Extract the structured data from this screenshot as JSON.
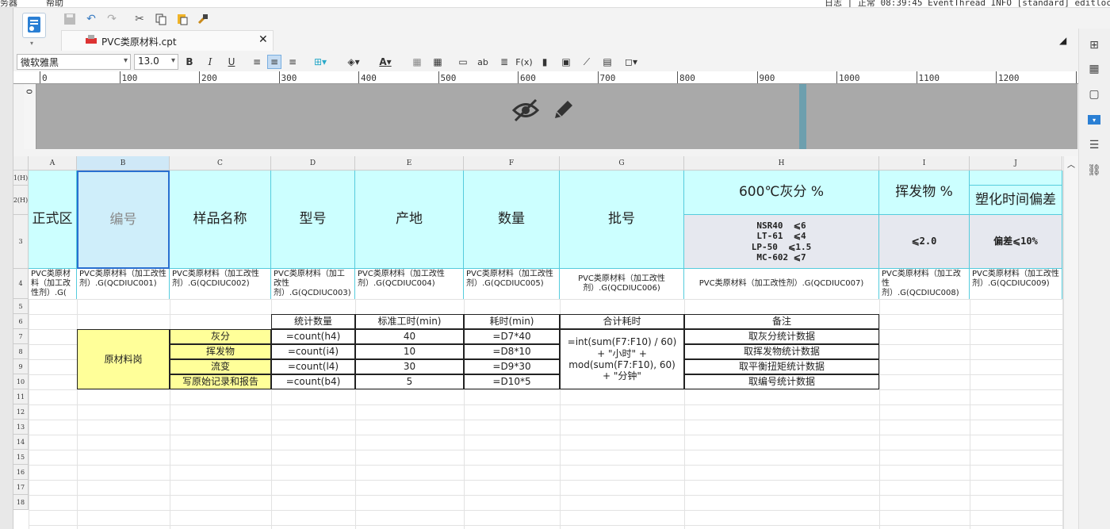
{
  "topbar": {
    "left1": "务器",
    "left2": "帮助",
    "right": "日志  | 正常 08:39:45 EventThread INFO [standard] editlock o"
  },
  "tab": {
    "title": "PVC类原材料.cpt"
  },
  "format": {
    "font": "微软雅黑",
    "size": "13.0",
    "bold": "B",
    "italic": "I",
    "underline": "U",
    "text_color": "A",
    "formula": "F(x)",
    "ab": "ab"
  },
  "ruler": {
    "ticks": [
      "0",
      "100",
      "200",
      "300",
      "400",
      "500",
      "600",
      "700",
      "800",
      "900",
      "1000",
      "1100",
      "1200",
      "13"
    ],
    "v_tick": "0"
  },
  "columns": [
    "A",
    "B",
    "C",
    "D",
    "E",
    "F",
    "G",
    "H",
    "I",
    "J"
  ],
  "rows": [
    "1(H)",
    "2(H)",
    "3",
    "4",
    "5",
    "6",
    "7",
    "8",
    "9",
    "10",
    "11",
    "12",
    "13",
    "14",
    "15",
    "16",
    "17",
    "18"
  ],
  "header": {
    "A": "正式区",
    "B": "编号",
    "C": "样品名称",
    "D": "型号",
    "E": "产地",
    "F": "数量",
    "G": "批号",
    "H": "600℃灰分 %",
    "I": "挥发物 %",
    "J": "塑化时间偏差"
  },
  "row3": {
    "H": "NSR40  ⩽6\nLT-61  ⩽4\nLP-50  ⩽1.5\nMC-602 ⩽7",
    "I": "⩽2.0",
    "J": "偏差⩽10%"
  },
  "row4": {
    "A": "PVC类原材料（加工改性剂）.G(",
    "B": "PVC类原材料（加工改性剂）.G(QCDIUC001)",
    "C": "PVC类原材料（加工改性剂）.G(QCDIUC002)",
    "D": "PVC类原材料（加工改性剂）.G(QCDIUC003)",
    "E": "PVC类原材料（加工改性剂）.G(QCDIUC004)",
    "F": "PVC类原材料（加工改性剂）.G(QCDIUC005)",
    "G": "PVC类原材料（加工改性剂）.G(QCDIUC006)",
    "H": "PVC类原材料（加工改性剂）.G(QCDIUC007)",
    "I": "PVC类原材料（加工改性剂）.G(QCDIUC008)",
    "J": "PVC类原材料（加工改性剂）.G(QCDIUC009)"
  },
  "stats": {
    "headers": [
      "统计数量",
      "标准工时(min)",
      "耗时(min)",
      "合计耗时",
      "备注"
    ],
    "group": "原材料岗",
    "rows": [
      {
        "name": "灰分",
        "count": "=count(h4)",
        "std": "40",
        "time": "=D7*40",
        "note": "取灰分统计数据"
      },
      {
        "name": "挥发物",
        "count": "=count(i4)",
        "std": "10",
        "time": "=D8*10",
        "note": "取挥发物统计数据"
      },
      {
        "name": "流变",
        "count": "=count(l4)",
        "std": "30",
        "time": "=D9*30",
        "note": "取平衡扭矩统计数据"
      },
      {
        "name": "写原始记录和报告",
        "count": "=count(b4)",
        "std": "5",
        "time": "=D10*5",
        "note": "取编号统计数据"
      }
    ],
    "total": "=int(sum(F7:F10) / 60) + \"小时\" + mod(sum(F7:F10), 60) + \"分钟\""
  },
  "colors": {
    "header_cyan": "#ccffff",
    "selected": "#cfe8f7",
    "yellow": "#ffff99",
    "accent": "#2a7fd4"
  }
}
